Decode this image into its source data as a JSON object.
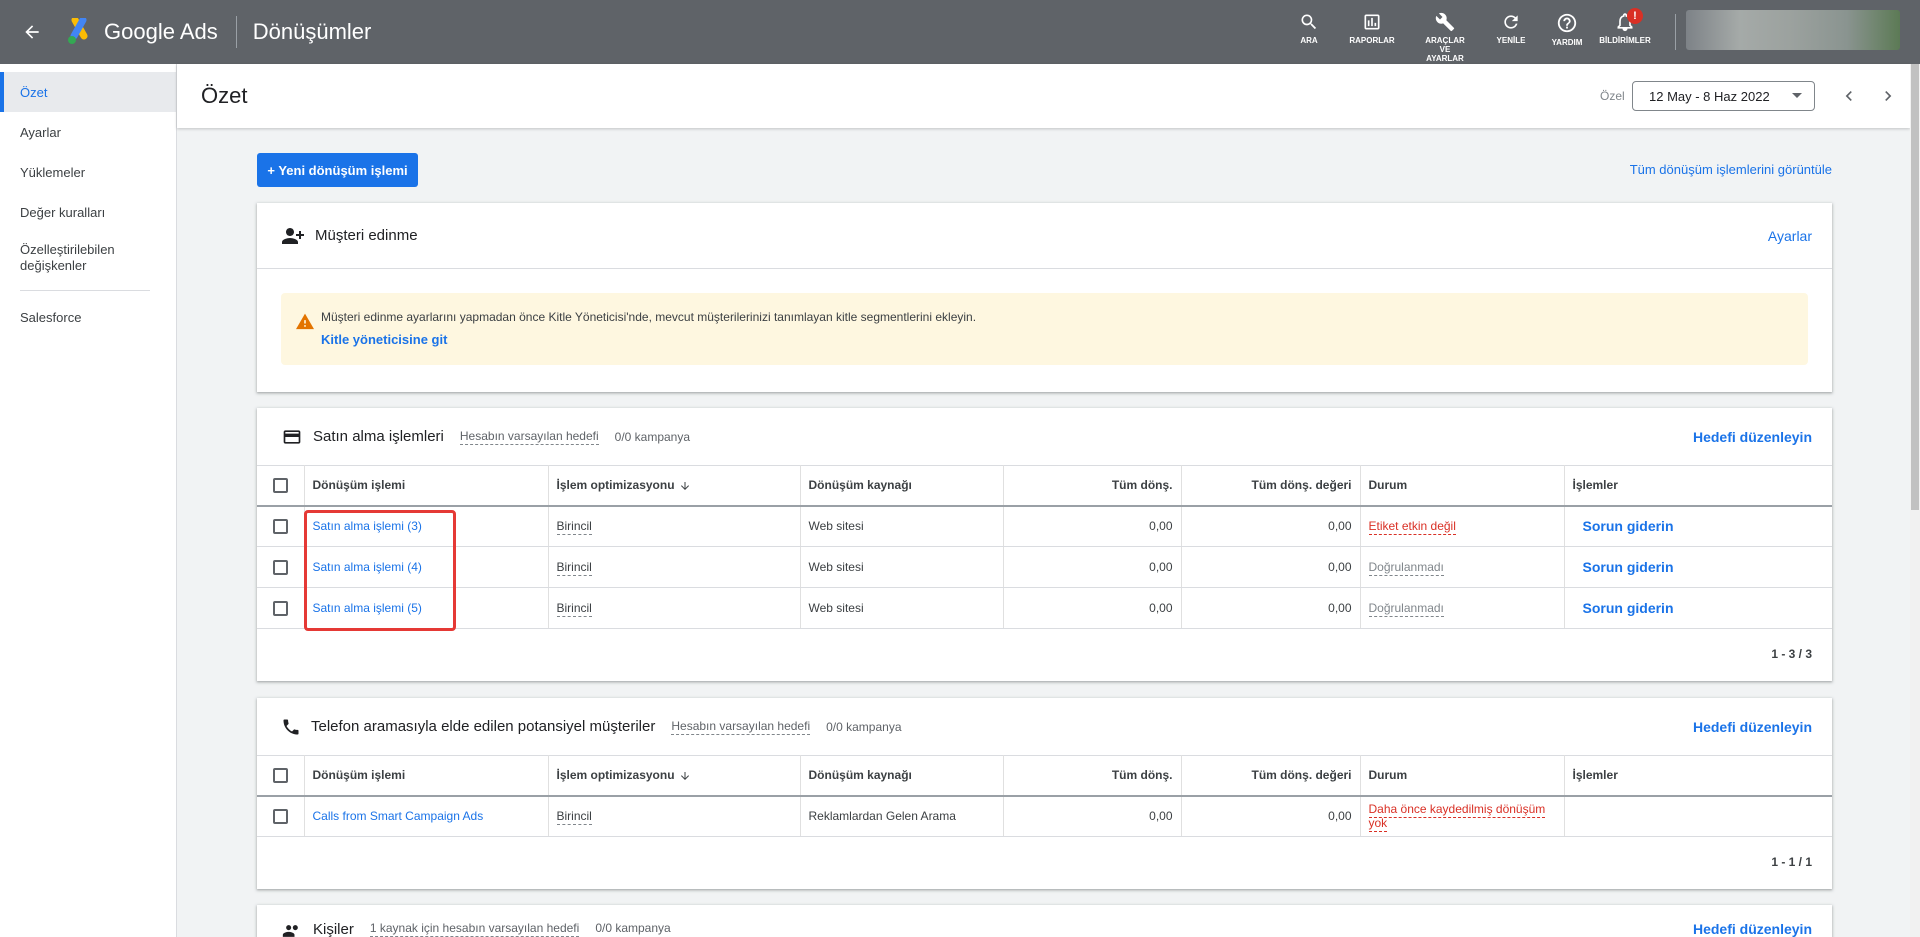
{
  "topbar": {
    "brand": "Google Ads",
    "page_title": "Dönüşümler",
    "tools": [
      {
        "label": "ARA",
        "icon": "search-icon"
      },
      {
        "label": "RAPORLAR",
        "icon": "reports-icon"
      },
      {
        "label": "ARAÇLAR VE AYARLAR",
        "icon": "wrench-icon"
      },
      {
        "label": "YENİLE",
        "icon": "refresh-icon"
      },
      {
        "label": "YARDIM",
        "icon": "help-icon"
      },
      {
        "label": "BİLDİRİMLER",
        "icon": "bell-icon",
        "badge": "!"
      }
    ]
  },
  "sidebar": {
    "items": [
      {
        "label": "Özet",
        "active": true
      },
      {
        "label": "Ayarlar"
      },
      {
        "label": "Yüklemeler"
      },
      {
        "label": "Değer kuralları"
      },
      {
        "label": "Özelleştirilebilen değişkenler"
      },
      {
        "label": "Salesforce"
      }
    ]
  },
  "header": {
    "title": "Özet",
    "date_label": "Özel",
    "date_range": "12 May - 8 Haz 2022"
  },
  "actions": {
    "new_button": "+ Yeni dönüşüm işlemi",
    "view_all": "Tüm dönüşüm işlemlerini görüntüle"
  },
  "customer_card": {
    "title": "Müşteri edinme",
    "settings_link": "Ayarlar",
    "alert_message": "Müşteri edinme ayarlarını yapmadan önce Kitle Yöneticisi'nde, mevcut müşterilerinizi tanımlayan kitle segmentlerini ekleyin.",
    "alert_link": "Kitle yöneticisine git"
  },
  "columns": {
    "action": "Dönüşüm işlemi",
    "optimization": "İşlem optimizasyonu",
    "source": "Dönüşüm kaynağı",
    "all_conv": "Tüm dönş.",
    "all_conv_value": "Tüm dönş. değeri",
    "status": "Durum",
    "actions": "İşlemler"
  },
  "purchase_card": {
    "title": "Satın alma işlemleri",
    "goal": "Hesabın varsayılan hedefi",
    "campaigns": "0/0 kampanya",
    "edit_link": "Hedefi düzenleyin",
    "rows": [
      {
        "name": "Satın alma işlemi (3)",
        "optimization": "Birincil",
        "source": "Web sitesi",
        "conv": "0,00",
        "value": "0,00",
        "status": "Etiket etkin değil",
        "status_type": "error",
        "action": "Sorun giderin"
      },
      {
        "name": "Satın alma işlemi (4)",
        "optimization": "Birincil",
        "source": "Web sitesi",
        "conv": "0,00",
        "value": "0,00",
        "status": "Doğrulanmadı",
        "status_type": "muted",
        "action": "Sorun giderin"
      },
      {
        "name": "Satın alma işlemi (5)",
        "optimization": "Birincil",
        "source": "Web sitesi",
        "conv": "0,00",
        "value": "0,00",
        "status": "Doğrulanmadı",
        "status_type": "muted",
        "action": "Sorun giderin"
      }
    ],
    "pager": "1 - 3 / 3"
  },
  "phone_card": {
    "title": "Telefon aramasıyla elde edilen potansiyel müşteriler",
    "goal": "Hesabın varsayılan hedefi",
    "campaigns": "0/0 kampanya",
    "edit_link": "Hedefi düzenleyin",
    "rows": [
      {
        "name": "Calls from Smart Campaign Ads",
        "optimization": "Birincil",
        "source": "Reklamlardan Gelen Arama",
        "conv": "0,00",
        "value": "0,00",
        "status": "Daha önce kaydedilmiş dönüşüm yok",
        "status_type": "error",
        "action": ""
      }
    ],
    "pager": "1 - 1 / 1"
  },
  "contacts_card": {
    "title": "Kişiler",
    "goal": "1 kaynak için hesabın varsayılan hedefi",
    "campaigns": "0/0 kampanya",
    "edit_link": "Hedefi düzenleyin"
  },
  "colors": {
    "topbar": "#5f6368",
    "accent": "#1a73e8",
    "error": "#d93025",
    "highlight": "#e53935",
    "alert_bg": "#fef7e0"
  }
}
